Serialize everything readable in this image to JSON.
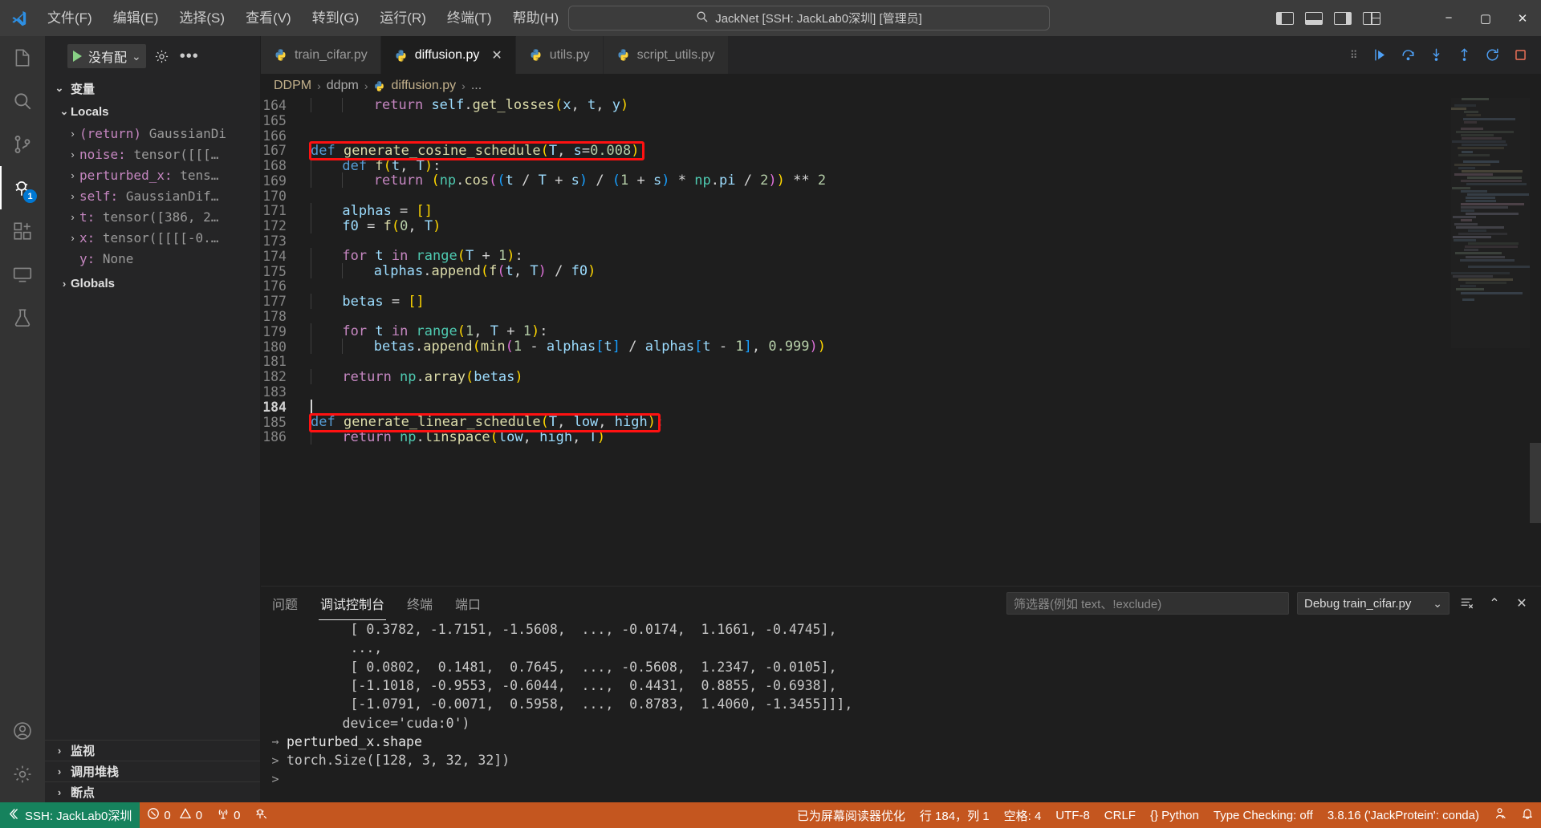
{
  "titlebar": {
    "logo_icon": "vscode-logo-icon",
    "menus": [
      "文件(F)",
      "编辑(E)",
      "选择(S)",
      "查看(V)",
      "转到(G)",
      "运行(R)",
      "终端(T)",
      "帮助(H)"
    ],
    "nav_back_icon": "arrow-left-icon",
    "nav_forward_icon": "arrow-right-icon",
    "command_center": {
      "search_icon": "search-icon",
      "text": "JackNet [SSH: JackLab0深圳] [管理员]"
    },
    "layout_icons": [
      "layout-sidebar-left-icon",
      "layout-panel-icon",
      "layout-sidebar-right-icon",
      "layout-grid-icon"
    ],
    "window_controls": {
      "minimize": "−",
      "maximize": "▢",
      "close": "✕"
    }
  },
  "activitybar": {
    "items": [
      {
        "name": "explorer",
        "icon": "files-icon",
        "active": false
      },
      {
        "name": "search",
        "icon": "search-icon",
        "active": false
      },
      {
        "name": "source-control",
        "icon": "source-control-icon",
        "active": false
      },
      {
        "name": "run-and-debug",
        "icon": "run-debug-icon",
        "active": true,
        "badge": "1"
      },
      {
        "name": "extensions",
        "icon": "extensions-icon",
        "active": false
      },
      {
        "name": "remote-explorer",
        "icon": "remote-explorer-icon",
        "active": false
      },
      {
        "name": "testing",
        "icon": "beaker-icon",
        "active": false
      }
    ],
    "bottom_items": [
      {
        "name": "accounts",
        "icon": "account-icon"
      },
      {
        "name": "manage",
        "icon": "gear-icon"
      }
    ]
  },
  "sidebar": {
    "toolbar": {
      "run_icon": "play-icon",
      "config_label": "没有配",
      "chevron_icon": "chevron-down-icon",
      "settings_icon": "gear-icon",
      "more_icon": "ellipsis-icon"
    },
    "variables_section": {
      "label": "变量",
      "expanded": true
    },
    "scopes": [
      {
        "label": "Locals",
        "expanded": true,
        "variables": [
          {
            "expandable": true,
            "name": "(return)",
            "value": "GaussianDi"
          },
          {
            "expandable": true,
            "name": "noise:",
            "value": "tensor([[[…"
          },
          {
            "expandable": true,
            "name": "perturbed_x:",
            "value": "tens…"
          },
          {
            "expandable": true,
            "name": "self:",
            "value": "GaussianDif…"
          },
          {
            "expandable": true,
            "name": "t:",
            "value": "tensor([386, 2…"
          },
          {
            "expandable": true,
            "name": "x:",
            "value": "tensor([[[[-0.…"
          },
          {
            "expandable": false,
            "name": "y:",
            "value": "None"
          }
        ]
      },
      {
        "label": "Globals",
        "expanded": false,
        "variables": []
      }
    ],
    "bottom_sections": [
      {
        "label": "监视",
        "expanded": false
      },
      {
        "label": "调用堆栈",
        "expanded": false
      },
      {
        "label": "断点",
        "expanded": false
      }
    ]
  },
  "editor": {
    "tabs": [
      {
        "label": "train_cifar.py",
        "icon": "python-icon",
        "active": false,
        "closable": false
      },
      {
        "label": "diffusion.py",
        "icon": "python-icon",
        "active": true,
        "closable": true,
        "close_icon": "close-icon"
      },
      {
        "label": "utils.py",
        "icon": "python-icon",
        "active": false,
        "closable": false
      },
      {
        "label": "script_utils.py",
        "icon": "python-icon",
        "active": false,
        "closable": false
      }
    ],
    "tab_actions": [
      "grip-icon",
      "debug-continue-icon",
      "debug-step-over-icon",
      "debug-step-into-icon",
      "debug-step-out-icon",
      "debug-restart-icon",
      "debug-stop-icon"
    ],
    "breadcrumbs": [
      "DDPM",
      "ddpm",
      "diffusion.py",
      "..."
    ],
    "breadcrumb_file_icon": "python-icon",
    "first_line_number": 164,
    "lines": [
      {
        "n": 164,
        "indent": 2,
        "tokens": [
          [
            "kwp",
            "return "
          ],
          [
            "self",
            "self"
          ],
          [
            "op",
            "."
          ],
          [
            "fn",
            "get_losses"
          ],
          [
            "par1",
            "("
          ],
          [
            "var",
            "x"
          ],
          [
            "op",
            ", "
          ],
          [
            "var",
            "t"
          ],
          [
            "op",
            ", "
          ],
          [
            "var",
            "y"
          ],
          [
            "par1",
            ")"
          ]
        ]
      },
      {
        "n": 165,
        "indent": 0,
        "tokens": []
      },
      {
        "n": 166,
        "indent": 0,
        "tokens": []
      },
      {
        "n": 167,
        "indent": 0,
        "highlight": true,
        "tokens": [
          [
            "kw",
            "def "
          ],
          [
            "fn",
            "generate_cosine_schedule"
          ],
          [
            "par1",
            "("
          ],
          [
            "var",
            "T"
          ],
          [
            "op",
            ", "
          ],
          [
            "var",
            "s"
          ],
          [
            "op",
            "="
          ],
          [
            "num",
            "0.008"
          ],
          [
            "par1",
            ")"
          ],
          [
            "op",
            ":"
          ]
        ]
      },
      {
        "n": 168,
        "indent": 1,
        "tokens": [
          [
            "kw",
            "def "
          ],
          [
            "fn",
            "f"
          ],
          [
            "par1",
            "("
          ],
          [
            "var",
            "t"
          ],
          [
            "op",
            ", "
          ],
          [
            "var",
            "T"
          ],
          [
            "par1",
            ")"
          ],
          [
            "op",
            ":"
          ]
        ]
      },
      {
        "n": 169,
        "indent": 2,
        "tokens": [
          [
            "kwp",
            "return "
          ],
          [
            "par1",
            "("
          ],
          [
            "prop",
            "np"
          ],
          [
            "op",
            "."
          ],
          [
            "fn",
            "cos"
          ],
          [
            "par2",
            "("
          ],
          [
            "par3",
            "("
          ],
          [
            "var",
            "t"
          ],
          [
            "op",
            " / "
          ],
          [
            "var",
            "T"
          ],
          [
            "op",
            " + "
          ],
          [
            "var",
            "s"
          ],
          [
            "par3",
            ")"
          ],
          [
            "op",
            " / "
          ],
          [
            "par3",
            "("
          ],
          [
            "num",
            "1"
          ],
          [
            "op",
            " + "
          ],
          [
            "var",
            "s"
          ],
          [
            "par3",
            ")"
          ],
          [
            "op",
            " * "
          ],
          [
            "prop",
            "np"
          ],
          [
            "op",
            "."
          ],
          [
            "var",
            "pi"
          ],
          [
            "op",
            " / "
          ],
          [
            "num",
            "2"
          ],
          [
            "par2",
            ")"
          ],
          [
            "par1",
            ")"
          ],
          [
            "op",
            " ** "
          ],
          [
            "num",
            "2"
          ]
        ]
      },
      {
        "n": 170,
        "indent": 0,
        "tokens": []
      },
      {
        "n": 171,
        "indent": 1,
        "tokens": [
          [
            "var",
            "alphas"
          ],
          [
            "op",
            " = "
          ],
          [
            "par1",
            "[]"
          ]
        ]
      },
      {
        "n": 172,
        "indent": 1,
        "tokens": [
          [
            "var",
            "f0"
          ],
          [
            "op",
            " = "
          ],
          [
            "fn",
            "f"
          ],
          [
            "par1",
            "("
          ],
          [
            "num",
            "0"
          ],
          [
            "op",
            ", "
          ],
          [
            "var",
            "T"
          ],
          [
            "par1",
            ")"
          ]
        ]
      },
      {
        "n": 173,
        "indent": 0,
        "tokens": []
      },
      {
        "n": 174,
        "indent": 1,
        "tokens": [
          [
            "kwp",
            "for "
          ],
          [
            "var",
            "t"
          ],
          [
            "kwp",
            " in "
          ],
          [
            "prop",
            "range"
          ],
          [
            "par1",
            "("
          ],
          [
            "var",
            "T"
          ],
          [
            "op",
            " + "
          ],
          [
            "num",
            "1"
          ],
          [
            "par1",
            ")"
          ],
          [
            "op",
            ":"
          ]
        ]
      },
      {
        "n": 175,
        "indent": 2,
        "tokens": [
          [
            "var",
            "alphas"
          ],
          [
            "op",
            "."
          ],
          [
            "fn",
            "append"
          ],
          [
            "par1",
            "("
          ],
          [
            "fn",
            "f"
          ],
          [
            "par2",
            "("
          ],
          [
            "var",
            "t"
          ],
          [
            "op",
            ", "
          ],
          [
            "var",
            "T"
          ],
          [
            "par2",
            ")"
          ],
          [
            "op",
            " / "
          ],
          [
            "var",
            "f0"
          ],
          [
            "par1",
            ")"
          ]
        ]
      },
      {
        "n": 176,
        "indent": 0,
        "tokens": []
      },
      {
        "n": 177,
        "indent": 1,
        "tokens": [
          [
            "var",
            "betas"
          ],
          [
            "op",
            " = "
          ],
          [
            "par1",
            "[]"
          ]
        ]
      },
      {
        "n": 178,
        "indent": 0,
        "tokens": []
      },
      {
        "n": 179,
        "indent": 1,
        "tokens": [
          [
            "kwp",
            "for "
          ],
          [
            "var",
            "t"
          ],
          [
            "kwp",
            " in "
          ],
          [
            "prop",
            "range"
          ],
          [
            "par1",
            "("
          ],
          [
            "num",
            "1"
          ],
          [
            "op",
            ", "
          ],
          [
            "var",
            "T"
          ],
          [
            "op",
            " + "
          ],
          [
            "num",
            "1"
          ],
          [
            "par1",
            ")"
          ],
          [
            "op",
            ":"
          ]
        ]
      },
      {
        "n": 180,
        "indent": 2,
        "tokens": [
          [
            "var",
            "betas"
          ],
          [
            "op",
            "."
          ],
          [
            "fn",
            "append"
          ],
          [
            "par1",
            "("
          ],
          [
            "fn",
            "min"
          ],
          [
            "par2",
            "("
          ],
          [
            "num",
            "1"
          ],
          [
            "op",
            " - "
          ],
          [
            "var",
            "alphas"
          ],
          [
            "par3",
            "["
          ],
          [
            "var",
            "t"
          ],
          [
            "par3",
            "]"
          ],
          [
            "op",
            " / "
          ],
          [
            "var",
            "alphas"
          ],
          [
            "par3",
            "["
          ],
          [
            "var",
            "t"
          ],
          [
            "op",
            " - "
          ],
          [
            "num",
            "1"
          ],
          [
            "par3",
            "]"
          ],
          [
            "op",
            ", "
          ],
          [
            "num",
            "0.999"
          ],
          [
            "par2",
            ")"
          ],
          [
            "par1",
            ")"
          ]
        ]
      },
      {
        "n": 181,
        "indent": 0,
        "tokens": []
      },
      {
        "n": 182,
        "indent": 1,
        "tokens": [
          [
            "kwp",
            "return "
          ],
          [
            "prop",
            "np"
          ],
          [
            "op",
            "."
          ],
          [
            "fn",
            "array"
          ],
          [
            "par1",
            "("
          ],
          [
            "var",
            "betas"
          ],
          [
            "par1",
            ")"
          ]
        ]
      },
      {
        "n": 183,
        "indent": 0,
        "tokens": []
      },
      {
        "n": 184,
        "indent": 0,
        "current": true,
        "caret": true,
        "tokens": []
      },
      {
        "n": 185,
        "indent": 0,
        "highlight": true,
        "tokens": [
          [
            "kw",
            "def "
          ],
          [
            "fn",
            "generate_linear_schedule"
          ],
          [
            "par1",
            "("
          ],
          [
            "var",
            "T"
          ],
          [
            "op",
            ", "
          ],
          [
            "var",
            "low"
          ],
          [
            "op",
            ", "
          ],
          [
            "var",
            "high"
          ],
          [
            "par1",
            ")"
          ],
          [
            "op",
            ":"
          ]
        ]
      },
      {
        "n": 186,
        "indent": 1,
        "tokens": [
          [
            "kwp",
            "return "
          ],
          [
            "prop",
            "np"
          ],
          [
            "op",
            "."
          ],
          [
            "fn",
            "linspace"
          ],
          [
            "par1",
            "("
          ],
          [
            "var",
            "low"
          ],
          [
            "op",
            ", "
          ],
          [
            "var",
            "high"
          ],
          [
            "op",
            ", "
          ],
          [
            "var",
            "T"
          ],
          [
            "par1",
            ")"
          ]
        ]
      }
    ]
  },
  "panel": {
    "tabs": [
      {
        "label": "问题",
        "active": false
      },
      {
        "label": "调试控制台",
        "active": true
      },
      {
        "label": "终端",
        "active": false
      },
      {
        "label": "端口",
        "active": false
      }
    ],
    "filter": {
      "placeholder": "筛选器(例如 text、!exclude)",
      "value": ""
    },
    "session": {
      "label": "Debug train_cifar.py",
      "chevron_icon": "chevron-down-icon"
    },
    "actions": [
      "clear-console-icon",
      "chevron-up-icon",
      "close-icon"
    ],
    "console_lines": [
      {
        "gutter": "",
        "text": "        [ 0.3782, -1.7151, -1.5608,  ..., -0.0174,  1.1661, -0.4745],",
        "style": "dim"
      },
      {
        "gutter": "",
        "text": "        ...,",
        "style": "dim"
      },
      {
        "gutter": "",
        "text": "        [ 0.0802,  0.1481,  0.7645,  ..., -0.5608,  1.2347, -0.0105],",
        "style": "dim"
      },
      {
        "gutter": "",
        "text": "        [-1.1018, -0.9553, -0.6044,  ...,  0.4431,  0.8855, -0.6938],",
        "style": "dim"
      },
      {
        "gutter": "",
        "text": "        [-1.0791, -0.0071,  0.5958,  ...,  0.8783,  1.4060, -1.3455]]],",
        "style": "dim"
      },
      {
        "gutter": "",
        "text": "       device='cuda:0')",
        "style": "dim"
      },
      {
        "gutter": "→",
        "text": "perturbed_x.shape",
        "style": "bold"
      },
      {
        "gutter": ">",
        "text": "torch.Size([128, 3, 32, 32])",
        "style": "dim"
      },
      {
        "gutter": ">",
        "text": "",
        "style": "dim"
      }
    ]
  },
  "statusbar": {
    "remote": {
      "icon": "remote-icon",
      "label": "SSH: JackLab0深圳"
    },
    "left_items": [
      {
        "name": "problems",
        "error_icon": "error-icon",
        "errors": "0",
        "warning_icon": "warning-icon",
        "warnings": "0"
      },
      {
        "name": "radio-tower",
        "icon": "radio-tower-icon",
        "count": "0"
      },
      {
        "name": "debug-console-action",
        "icon": "debug-alt-icon"
      }
    ],
    "right_items": [
      {
        "name": "screen-reader",
        "label": "已为屏幕阅读器优化"
      },
      {
        "name": "cursor-position",
        "label": "行 184，列 1"
      },
      {
        "name": "indentation",
        "label": "空格: 4"
      },
      {
        "name": "encoding",
        "label": "UTF-8"
      },
      {
        "name": "eol",
        "label": "CRLF"
      },
      {
        "name": "language-mode",
        "label": "{} Python"
      },
      {
        "name": "type-checking",
        "label": "Type Checking: off"
      },
      {
        "name": "python-interpreter",
        "label": "3.8.16 ('JackProtein': conda)"
      },
      {
        "name": "remote-account",
        "icon": "feedback-icon"
      },
      {
        "name": "notifications",
        "icon": "bell-icon"
      }
    ]
  },
  "colors": {
    "titlebar_bg": "#3c3c3c",
    "activitybar_bg": "#333333",
    "sidebar_bg": "#252526",
    "editor_bg": "#1e1e1e",
    "statusbar_bg": "#c4561f",
    "remote_bg": "#16825d",
    "accent_blue": "#0078d4",
    "highlight_red": "#ff1111"
  }
}
